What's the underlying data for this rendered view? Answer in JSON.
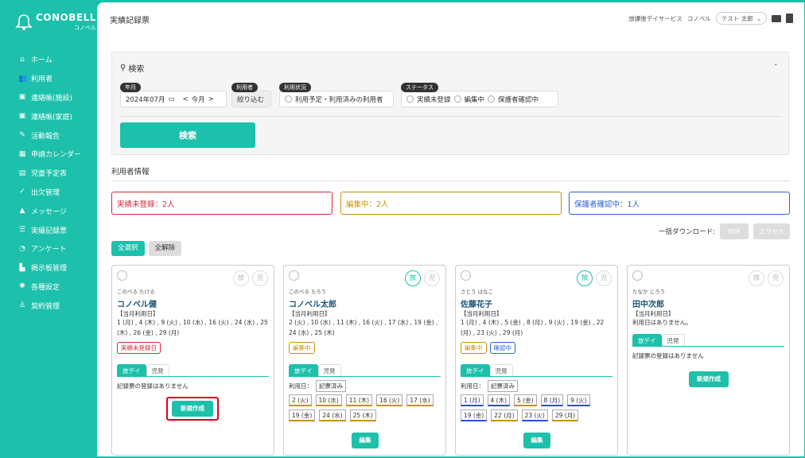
{
  "brand": {
    "name": "CONOBELL",
    "sub": "コノベル"
  },
  "nav": [
    {
      "label": "ホーム",
      "icon": "home-icon"
    },
    {
      "label": "利用者",
      "icon": "users-icon"
    },
    {
      "label": "連絡帳(施設)",
      "icon": "contact-book-icon"
    },
    {
      "label": "連絡帳(家庭)",
      "icon": "contact-book-home-icon"
    },
    {
      "label": "活動報告",
      "icon": "report-icon"
    },
    {
      "label": "申請カレンダー",
      "icon": "calendar-icon"
    },
    {
      "label": "児童予定表",
      "icon": "schedule-icon"
    },
    {
      "label": "出欠管理",
      "icon": "attendance-icon"
    },
    {
      "label": "メッセージ",
      "icon": "bell-icon"
    },
    {
      "label": "実績記録票",
      "icon": "list-icon"
    },
    {
      "label": "アンケート",
      "icon": "pie-chart-icon"
    },
    {
      "label": "掲示板管理",
      "icon": "board-icon"
    },
    {
      "label": "各種設定",
      "icon": "gear-icon"
    },
    {
      "label": "契約管理",
      "icon": "contract-icon"
    }
  ],
  "page_title": "実績記録票",
  "topbar": {
    "service": "放課後デイサービス",
    "company": "コノベル",
    "user": "テスト 太郎"
  },
  "search": {
    "title": "検索",
    "collapse": "-",
    "ym_label": "年月",
    "ym_value": "2024年07月",
    "prev": "<",
    "today": "今月",
    "next": ">",
    "user_label": "利用者",
    "user_btn": "絞り込む",
    "usage_label": "利用状況",
    "usage_opt": "利用予定・利用済みの利用者",
    "status_label": "ステータス",
    "status_opts": [
      "実績未登録",
      "編集中",
      "保護者確認中"
    ],
    "submit": "検索"
  },
  "info_title": "利用者情報",
  "stats": [
    {
      "text": "実績未登録：2人",
      "color": "#d9283d"
    },
    {
      "text": "編集中：2人",
      "color": "#c8920a"
    },
    {
      "text": "保護者確認中：1人",
      "color": "#2c62d6"
    }
  ],
  "download": {
    "label": "一括ダウンロード:",
    "pdf": "PDF",
    "excel": "エクセル"
  },
  "select_all": "全選択",
  "clear_all": "全解除",
  "cards": [
    {
      "kana": "このべる たける",
      "name": "コノベル健",
      "toggle_a": "放",
      "toggle_b": "児",
      "usage_label": "【当月利用日】",
      "usage_dates": "1 (月) , 4 (木) , 9 (火) , 10 (水) , 16 (火) , 24 (水) , 25 (木) , 26 (金) , 29 (月)",
      "badges": [
        "実績未登録日"
      ],
      "tab_a": "放デイ",
      "tab_b": "児発",
      "note": "記録票の登録はありません",
      "button": "新規作成"
    },
    {
      "kana": "このべる たろう",
      "name": "コノベル太郎",
      "toggle_a": "放",
      "toggle_b": "児",
      "usage_label": "【当月利用日】",
      "usage_dates": "2 (火) , 10 (水) , 11 (木) , 16 (火) , 17 (水) , 19 (金) , 24 (水) , 25 (木)",
      "badges": [
        "編集中"
      ],
      "tab_a": "放デイ",
      "tab_b": "児発",
      "row_label": "利用日：",
      "row_chip": "記票済み",
      "chips": [
        "2 (火)",
        "10 (水)",
        "11 (木)",
        "16 (火)",
        "17 (水)",
        "19 (金)",
        "24 (水)",
        "25 (木)"
      ],
      "button": "編集"
    },
    {
      "kana": "さとう はなこ",
      "name": "佐藤花子",
      "toggle_a": "放",
      "toggle_b": "児",
      "usage_label": "【当月利用日】",
      "usage_dates": "1 (月) , 4 (木) , 5 (金) , 8 (月) , 9 (火) , 19 (金) , 22 (月) , 23 (火) , 29 (月)",
      "badges": [
        "編集中",
        "確認中"
      ],
      "tab_a": "放デイ",
      "tab_b": "児発",
      "row_label": "利用日：",
      "row_chip": "記票済み",
      "chips": [
        "1 (月)",
        "4 (木)",
        "5 (金)",
        "8 (月)",
        "9 (火)",
        "19 (金)",
        "22 (月)",
        "23 (火)",
        "29 (月)"
      ],
      "button": "編集"
    },
    {
      "kana": "たなか じろう",
      "name": "田中次郎",
      "toggle_a": "放",
      "toggle_b": "児",
      "usage_label": "【当月利用日】",
      "usage_dates": "利用日はありません。",
      "tab_a": "放デイ",
      "tab_b": "児発",
      "note": "記録票の登録はありません",
      "button": "新規作成"
    }
  ]
}
